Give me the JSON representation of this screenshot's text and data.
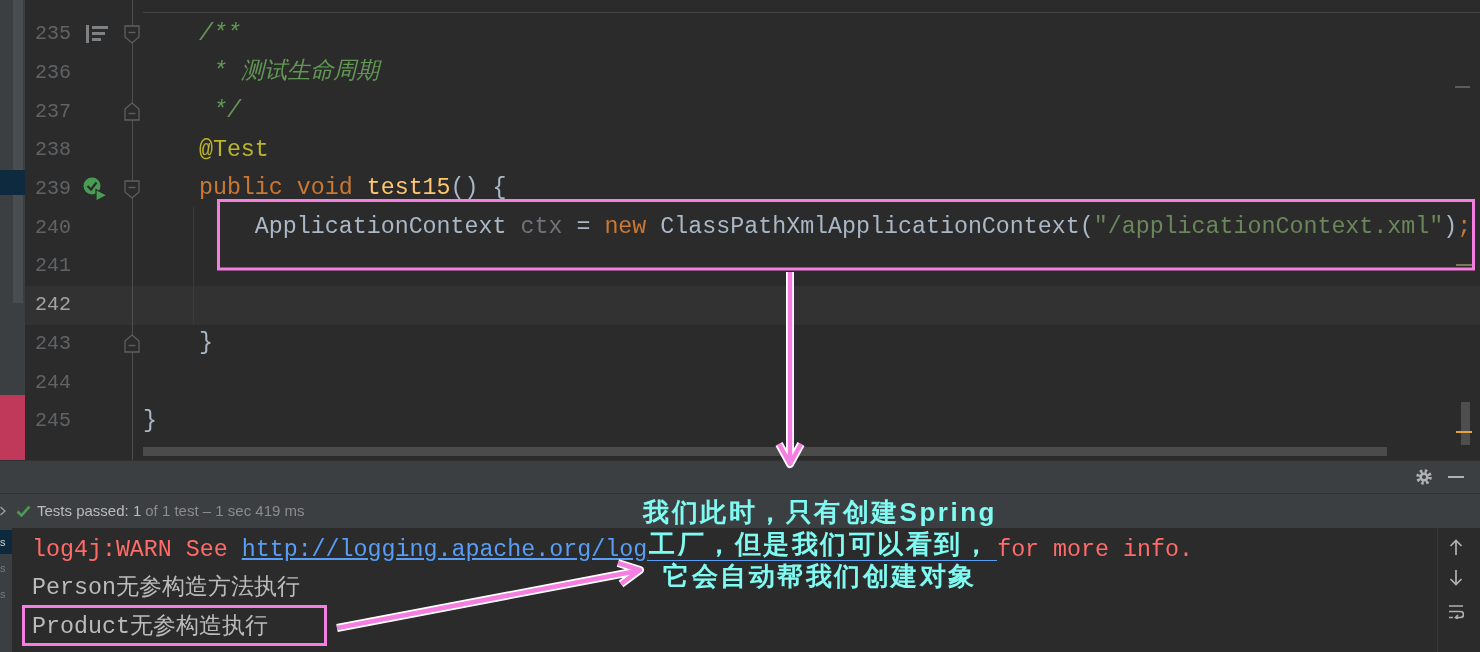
{
  "editor": {
    "lines": [
      {
        "number": "235",
        "current": false,
        "gutter_icons": [
          {
            "kind": "doc"
          },
          {
            "kind": "fold_start"
          }
        ],
        "tokens": [
          {
            "text": "    /**",
            "kind": "comment"
          }
        ]
      },
      {
        "number": "236",
        "current": false,
        "tokens": [
          {
            "text": "     * 测试生命周期",
            "kind": "comment"
          }
        ]
      },
      {
        "number": "237",
        "current": false,
        "gutter_icons": [
          {
            "kind": "fold_end"
          }
        ],
        "tokens": [
          {
            "text": "     */",
            "kind": "comment"
          }
        ]
      },
      {
        "number": "238",
        "current": false,
        "tokens": [
          {
            "text": "    @Test",
            "kind": "annotation"
          }
        ]
      },
      {
        "number": "239",
        "current": false,
        "gutter_icons": [
          {
            "kind": "run"
          },
          {
            "kind": "fold_start"
          }
        ],
        "tokens": [
          {
            "text": "    public void ",
            "kind": "keyword"
          },
          {
            "text": "test15",
            "kind": "method"
          },
          {
            "text": "() {",
            "kind": "plain"
          }
        ]
      },
      {
        "number": "240",
        "current": false,
        "tokens": [
          {
            "text": "        ApplicationContext ",
            "kind": "plain"
          },
          {
            "text": "ctx",
            "kind": "unused"
          },
          {
            "text": " = ",
            "kind": "plain"
          },
          {
            "text": "new",
            "kind": "keyword"
          },
          {
            "text": " ClassPathXmlApplicationContext(",
            "kind": "plain"
          },
          {
            "text": "\"/applicationContext.xml\"",
            "kind": "string"
          },
          {
            "text": ")",
            "kind": "plain"
          },
          {
            "text": ";",
            "kind": "keyword"
          }
        ]
      },
      {
        "number": "241",
        "current": false
      },
      {
        "number": "242",
        "current": true
      },
      {
        "number": "243",
        "current": false,
        "gutter_icons": [
          {
            "kind": "fold_end"
          }
        ],
        "tokens": [
          {
            "text": "    }",
            "kind": "plain"
          }
        ]
      },
      {
        "number": "244",
        "current": false
      },
      {
        "number": "245",
        "current": false,
        "tokens": [
          {
            "text": "}",
            "kind": "plain"
          }
        ]
      }
    ]
  },
  "run_panel": {
    "status": {
      "passed": "Tests passed: 1",
      "detail": "of 1 test – 1 sec 419 ms"
    },
    "tree": [
      {
        "label": "s",
        "selected": true
      },
      {
        "label": "s",
        "selected": false
      },
      {
        "label": "s",
        "selected": false
      }
    ],
    "console": [
      {
        "segments": [
          {
            "text": "log4j:WARN See ",
            "kind": "error"
          },
          {
            "text": "http://logging.apache.org/log",
            "kind": "link"
          },
          {
            "kind": "covered"
          },
          {
            "text": "for more info.",
            "kind": "error"
          }
        ]
      },
      {
        "segments": [
          {
            "text": "Person无参构造方法执行",
            "kind": "output"
          }
        ]
      },
      {
        "segments": [
          {
            "text": "Product无参构造执行",
            "kind": "output"
          }
        ]
      }
    ]
  },
  "annotation": {
    "lines": [
      "我们此时，只有创建Spring",
      "工厂，但是我们可以看到，",
      "它会自动帮我们创建对象"
    ]
  }
}
